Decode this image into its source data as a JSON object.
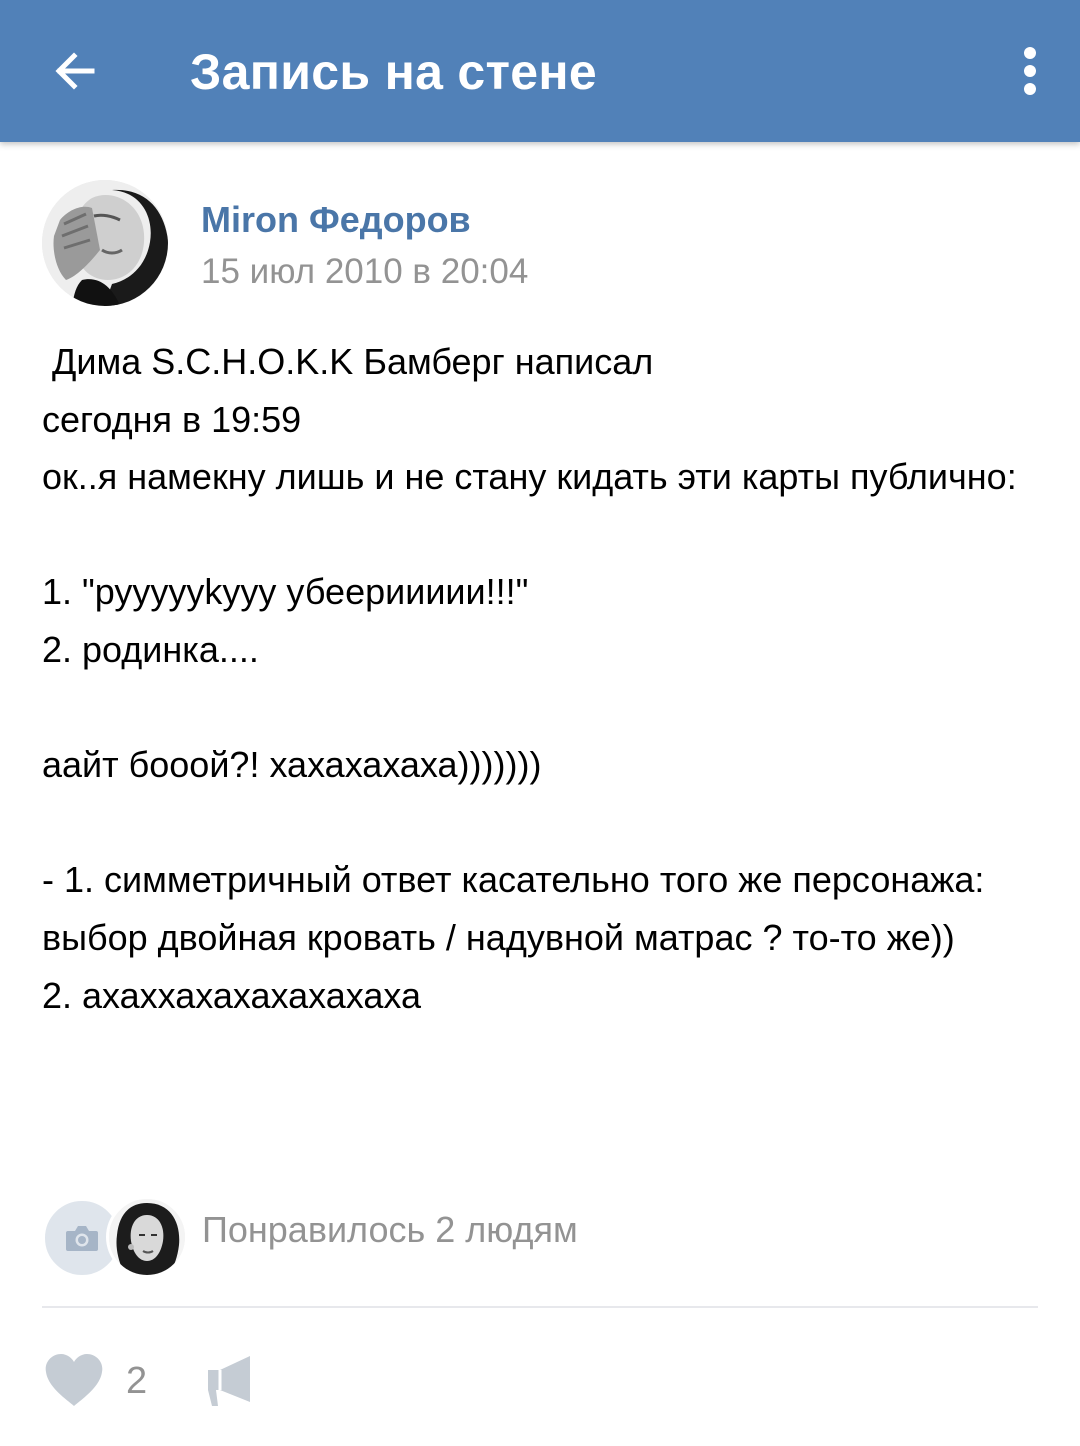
{
  "header": {
    "title": "Запись на стене",
    "back_icon": "arrow-left-icon",
    "menu_icon": "more-vertical-icon",
    "background_color": "#5181b8"
  },
  "post": {
    "author": "Miron Федоров",
    "date": "15 июл 2010 в 20:04",
    "text": " Дима S.C.H.O.K.K Бамберг написал\nсегодня в 19:59\nок..я намекну лишь и не стану кидать эти карты публично:\n\n1. \"руууууkуyy убеериииии!!!\"\n2. родинка....\n\nаайт бооой?! хахахахаха)))))))\n\n- 1. симметричный ответ касательно того же персонажа: выбор двойная кровать / надувной матрас ? то-то же))\n2. ахаххахахахахахаха"
  },
  "likes": {
    "summary": "Понравилось 2 людям",
    "count": "2"
  },
  "colors": {
    "accent": "#4a76a8",
    "secondary_text": "#939393",
    "icon_gray": "#c5ccd4"
  }
}
